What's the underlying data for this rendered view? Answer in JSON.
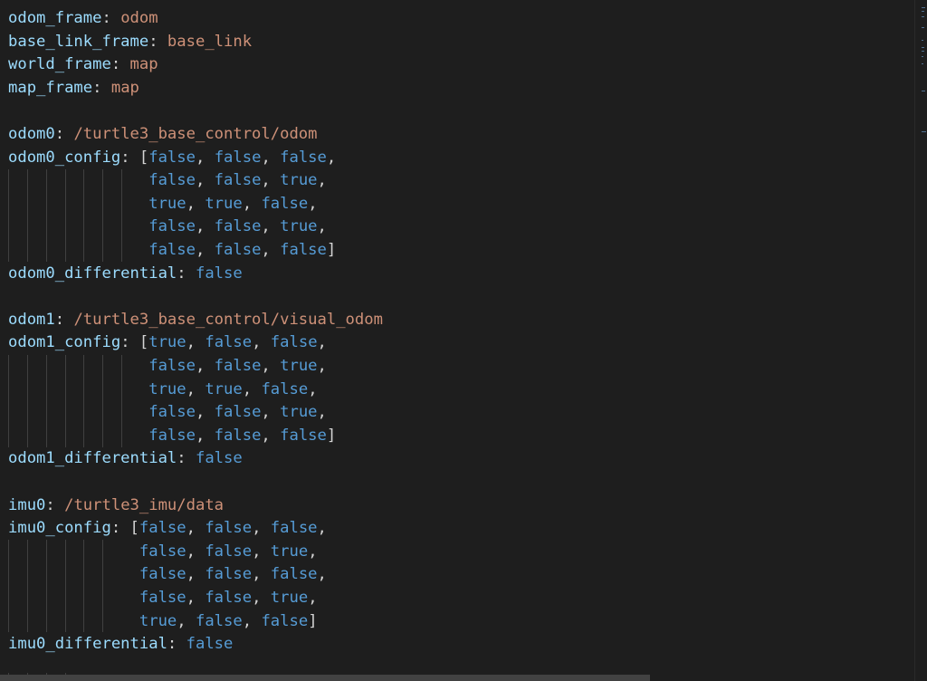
{
  "editor": {
    "lines": [
      {
        "tokens": [
          {
            "t": "odom_frame",
            "c": "k"
          },
          {
            "t": ": ",
            "c": "p"
          },
          {
            "t": "odom",
            "c": "s"
          }
        ]
      },
      {
        "tokens": [
          {
            "t": "base_link_frame",
            "c": "k"
          },
          {
            "t": ": ",
            "c": "p"
          },
          {
            "t": "base_link",
            "c": "s"
          }
        ]
      },
      {
        "tokens": [
          {
            "t": "world_frame",
            "c": "k"
          },
          {
            "t": ": ",
            "c": "p"
          },
          {
            "t": "map",
            "c": "s"
          }
        ]
      },
      {
        "tokens": [
          {
            "t": "map_frame",
            "c": "k"
          },
          {
            "t": ": ",
            "c": "p"
          },
          {
            "t": "map",
            "c": "s"
          }
        ]
      },
      {
        "tokens": []
      },
      {
        "tokens": [
          {
            "t": "odom0",
            "c": "k"
          },
          {
            "t": ": ",
            "c": "p"
          },
          {
            "t": "/turtle3_base_control/odom",
            "c": "s"
          }
        ]
      },
      {
        "tokens": [
          {
            "t": "odom0_config",
            "c": "k"
          },
          {
            "t": ": [",
            "c": "p"
          },
          {
            "t": "false",
            "c": "b"
          },
          {
            "t": ", ",
            "c": "p"
          },
          {
            "t": "false",
            "c": "b"
          },
          {
            "t": ", ",
            "c": "p"
          },
          {
            "t": "false",
            "c": "b"
          },
          {
            "t": ",",
            "c": "p"
          }
        ]
      },
      {
        "tokens": [
          {
            "t": "               ",
            "c": "p"
          },
          {
            "t": "false",
            "c": "b"
          },
          {
            "t": ", ",
            "c": "p"
          },
          {
            "t": "false",
            "c": "b"
          },
          {
            "t": ", ",
            "c": "p"
          },
          {
            "t": "true",
            "c": "b"
          },
          {
            "t": ",",
            "c": "p"
          }
        ]
      },
      {
        "tokens": [
          {
            "t": "               ",
            "c": "p"
          },
          {
            "t": "true",
            "c": "b"
          },
          {
            "t": ", ",
            "c": "p"
          },
          {
            "t": "true",
            "c": "b"
          },
          {
            "t": ", ",
            "c": "p"
          },
          {
            "t": "false",
            "c": "b"
          },
          {
            "t": ",",
            "c": "p"
          }
        ]
      },
      {
        "tokens": [
          {
            "t": "               ",
            "c": "p"
          },
          {
            "t": "false",
            "c": "b"
          },
          {
            "t": ", ",
            "c": "p"
          },
          {
            "t": "false",
            "c": "b"
          },
          {
            "t": ", ",
            "c": "p"
          },
          {
            "t": "true",
            "c": "b"
          },
          {
            "t": ",",
            "c": "p"
          }
        ]
      },
      {
        "tokens": [
          {
            "t": "               ",
            "c": "p"
          },
          {
            "t": "false",
            "c": "b"
          },
          {
            "t": ", ",
            "c": "p"
          },
          {
            "t": "false",
            "c": "b"
          },
          {
            "t": ", ",
            "c": "p"
          },
          {
            "t": "false",
            "c": "b"
          },
          {
            "t": "]",
            "c": "p"
          }
        ]
      },
      {
        "tokens": [
          {
            "t": "odom0_differential",
            "c": "k"
          },
          {
            "t": ": ",
            "c": "p"
          },
          {
            "t": "false",
            "c": "b"
          }
        ]
      },
      {
        "tokens": []
      },
      {
        "tokens": [
          {
            "t": "odom1",
            "c": "k"
          },
          {
            "t": ": ",
            "c": "p"
          },
          {
            "t": "/turtle3_base_control/visual_odom",
            "c": "s"
          }
        ]
      },
      {
        "tokens": [
          {
            "t": "odom1_config",
            "c": "k"
          },
          {
            "t": ": [",
            "c": "p"
          },
          {
            "t": "true",
            "c": "b"
          },
          {
            "t": ", ",
            "c": "p"
          },
          {
            "t": "false",
            "c": "b"
          },
          {
            "t": ", ",
            "c": "p"
          },
          {
            "t": "false",
            "c": "b"
          },
          {
            "t": ",",
            "c": "p"
          }
        ]
      },
      {
        "tokens": [
          {
            "t": "               ",
            "c": "p"
          },
          {
            "t": "false",
            "c": "b"
          },
          {
            "t": ", ",
            "c": "p"
          },
          {
            "t": "false",
            "c": "b"
          },
          {
            "t": ", ",
            "c": "p"
          },
          {
            "t": "true",
            "c": "b"
          },
          {
            "t": ",",
            "c": "p"
          }
        ]
      },
      {
        "tokens": [
          {
            "t": "               ",
            "c": "p"
          },
          {
            "t": "true",
            "c": "b"
          },
          {
            "t": ", ",
            "c": "p"
          },
          {
            "t": "true",
            "c": "b"
          },
          {
            "t": ", ",
            "c": "p"
          },
          {
            "t": "false",
            "c": "b"
          },
          {
            "t": ",",
            "c": "p"
          }
        ]
      },
      {
        "tokens": [
          {
            "t": "               ",
            "c": "p"
          },
          {
            "t": "false",
            "c": "b"
          },
          {
            "t": ", ",
            "c": "p"
          },
          {
            "t": "false",
            "c": "b"
          },
          {
            "t": ", ",
            "c": "p"
          },
          {
            "t": "true",
            "c": "b"
          },
          {
            "t": ",",
            "c": "p"
          }
        ]
      },
      {
        "tokens": [
          {
            "t": "               ",
            "c": "p"
          },
          {
            "t": "false",
            "c": "b"
          },
          {
            "t": ", ",
            "c": "p"
          },
          {
            "t": "false",
            "c": "b"
          },
          {
            "t": ", ",
            "c": "p"
          },
          {
            "t": "false",
            "c": "b"
          },
          {
            "t": "]",
            "c": "p"
          }
        ]
      },
      {
        "tokens": [
          {
            "t": "odom1_differential",
            "c": "k"
          },
          {
            "t": ": ",
            "c": "p"
          },
          {
            "t": "false",
            "c": "b"
          }
        ]
      },
      {
        "tokens": []
      },
      {
        "tokens": [
          {
            "t": "imu0",
            "c": "k"
          },
          {
            "t": ": ",
            "c": "p"
          },
          {
            "t": "/turtle3_imu/data",
            "c": "s"
          }
        ]
      },
      {
        "tokens": [
          {
            "t": "imu0_config",
            "c": "k"
          },
          {
            "t": ": [",
            "c": "p"
          },
          {
            "t": "false",
            "c": "b"
          },
          {
            "t": ", ",
            "c": "p"
          },
          {
            "t": "false",
            "c": "b"
          },
          {
            "t": ", ",
            "c": "p"
          },
          {
            "t": "false",
            "c": "b"
          },
          {
            "t": ",",
            "c": "p"
          }
        ]
      },
      {
        "tokens": [
          {
            "t": "              ",
            "c": "p"
          },
          {
            "t": "false",
            "c": "b"
          },
          {
            "t": ", ",
            "c": "p"
          },
          {
            "t": "false",
            "c": "b"
          },
          {
            "t": ", ",
            "c": "p"
          },
          {
            "t": "true",
            "c": "b"
          },
          {
            "t": ",",
            "c": "p"
          }
        ]
      },
      {
        "tokens": [
          {
            "t": "              ",
            "c": "p"
          },
          {
            "t": "false",
            "c": "b"
          },
          {
            "t": ", ",
            "c": "p"
          },
          {
            "t": "false",
            "c": "b"
          },
          {
            "t": ", ",
            "c": "p"
          },
          {
            "t": "false",
            "c": "b"
          },
          {
            "t": ",",
            "c": "p"
          }
        ]
      },
      {
        "tokens": [
          {
            "t": "              ",
            "c": "p"
          },
          {
            "t": "false",
            "c": "b"
          },
          {
            "t": ", ",
            "c": "p"
          },
          {
            "t": "false",
            "c": "b"
          },
          {
            "t": ", ",
            "c": "p"
          },
          {
            "t": "true",
            "c": "b"
          },
          {
            "t": ",",
            "c": "p"
          }
        ]
      },
      {
        "tokens": [
          {
            "t": "              ",
            "c": "p"
          },
          {
            "t": "true",
            "c": "b"
          },
          {
            "t": ", ",
            "c": "p"
          },
          {
            "t": "false",
            "c": "b"
          },
          {
            "t": ", ",
            "c": "p"
          },
          {
            "t": "false",
            "c": "b"
          },
          {
            "t": "]",
            "c": "p"
          }
        ]
      },
      {
        "tokens": [
          {
            "t": "imu0_differential",
            "c": "k"
          },
          {
            "t": ": ",
            "c": "p"
          },
          {
            "t": "false",
            "c": "b"
          }
        ]
      }
    ]
  },
  "colors": {
    "background": "#1e1e1e",
    "key": "#9cdcfe",
    "string": "#ce9178",
    "boolean": "#569cd6",
    "punctuation": "#d4d4d4",
    "indent_guide": "#404040",
    "scrollbar": "#424242"
  }
}
